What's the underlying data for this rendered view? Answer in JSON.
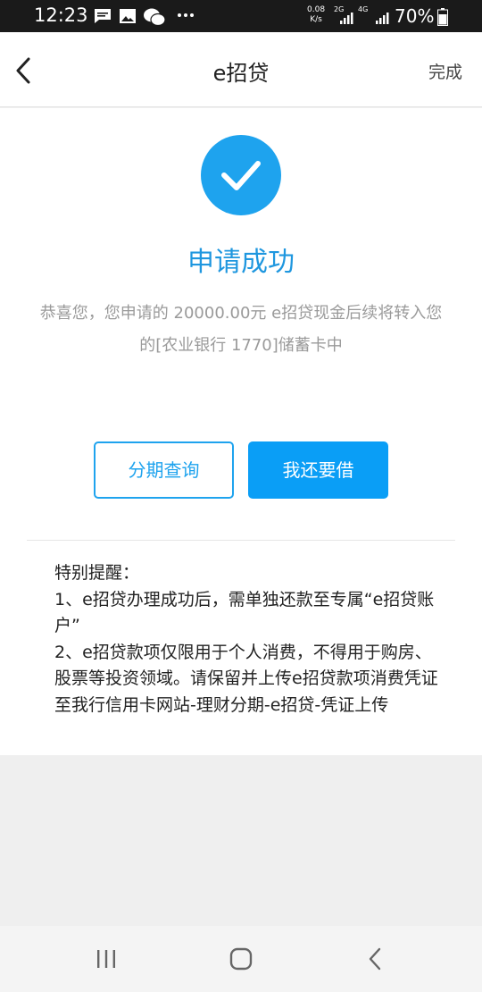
{
  "status_bar": {
    "time": "12:23",
    "net_speed_value": "0.08",
    "net_speed_unit": "K/s",
    "sim1_label": "2G",
    "sim2_label": "4G",
    "battery": "70%"
  },
  "nav": {
    "title": "e招贷",
    "done_label": "完成"
  },
  "result": {
    "title": "申请成功",
    "message_line1": "恭喜您，您申请的 20000.00元 e招贷现金后续将转入您",
    "message_line2": "的[农业银行 1770]储蓄卡中"
  },
  "actions": {
    "installment_query_label": "分期查询",
    "borrow_more_label": "我还要借"
  },
  "notice": {
    "heading": "特别提醒：",
    "item1": "1、e招贷办理成功后，需单独还款至专属“e招贷账户”",
    "item2": "2、e招贷款项仅限用于个人消费，不得用于购房、股票等投资领域。请保留并上传e招贷款项消费凭证至我行信用卡网站-理财分期-e招贷-凭证上传"
  },
  "colors": {
    "accent": "#1ea3ee",
    "primary_button": "#0a9ef6",
    "title_blue": "#1f97df"
  },
  "icons": [
    "message-icon",
    "image-icon",
    "wechat-icon",
    "more-icon",
    "signal-icon",
    "battery-icon",
    "back-arrow-icon",
    "check-icon",
    "recent-apps-icon",
    "home-icon",
    "back-icon"
  ]
}
